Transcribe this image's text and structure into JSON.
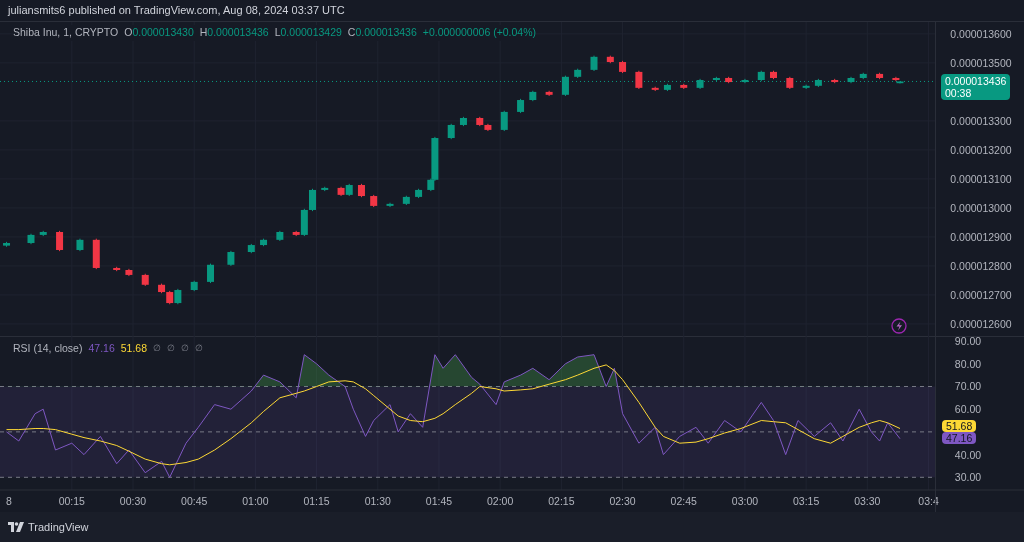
{
  "published": "juliansmits6 published on TradingView.com, Aug 08, 2024 03:37 UTC",
  "legend": {
    "symbol": "Shiba Inu, 1, CRYPTO",
    "ohlc": [
      {
        "label": "O",
        "value": "0.000013430"
      },
      {
        "label": "H",
        "value": "0.000013436"
      },
      {
        "label": "L",
        "value": "0.000013429"
      },
      {
        "label": "C",
        "value": "0.000013436"
      }
    ],
    "change": "+0.000000006 (+0.04%)"
  },
  "price_chart": {
    "chart_data": {
      "type": "candlestick",
      "grid": true,
      "x": [
        -1,
        5,
        8,
        12,
        17,
        21,
        26,
        29,
        33,
        37,
        39,
        41,
        45,
        49,
        54,
        59,
        62,
        66,
        70,
        72,
        74,
        77,
        81,
        83,
        86,
        89,
        93,
        97,
        100,
        103,
        104,
        108,
        111,
        115,
        117,
        121,
        125,
        128,
        132,
        136,
        139,
        143,
        147,
        150,
        154,
        158,
        161,
        165,
        169,
        173,
        176,
        180,
        184,
        187,
        191,
        195,
        198,
        202,
        206,
        209,
        213,
        217,
        218
      ],
      "xlim": [
        -2.6,
        248.4
      ],
      "ohlc": [
        [
          1.287e-05,
          1.2883e-05,
          1.2866e-05,
          1.2879e-05
        ],
        [
          1.2879e-05,
          1.2911e-05,
          1.2875e-05,
          1.2907e-05
        ],
        [
          1.2907e-05,
          1.2921e-05,
          1.2903e-05,
          1.2917e-05
        ],
        [
          1.2917e-05,
          1.2921e-05,
          1.2851e-05,
          1.2855e-05
        ],
        [
          1.2855e-05,
          1.2894e-05,
          1.2851e-05,
          1.289e-05
        ],
        [
          1.289e-05,
          1.2894e-05,
          1.2789e-05,
          1.2793e-05
        ],
        [
          1.2793e-05,
          1.2797e-05,
          1.2782e-05,
          1.2786e-05
        ],
        [
          1.2786e-05,
          1.279e-05,
          1.2765e-05,
          1.2769e-05
        ],
        [
          1.2769e-05,
          1.2773e-05,
          1.2731e-05,
          1.2735e-05
        ],
        [
          1.2735e-05,
          1.2739e-05,
          1.2706e-05,
          1.271e-05
        ],
        [
          1.271e-05,
          1.2714e-05,
          1.2668e-05,
          1.2672e-05
        ],
        [
          1.2672e-05,
          1.2721e-05,
          1.2668e-05,
          1.2717e-05
        ],
        [
          1.2717e-05,
          1.2749e-05,
          1.2713e-05,
          1.2745e-05
        ],
        [
          1.2745e-05,
          1.2808e-05,
          1.2741e-05,
          1.2804e-05
        ],
        [
          1.2804e-05,
          1.2852e-05,
          1.28e-05,
          1.2848e-05
        ],
        [
          1.2848e-05,
          1.2876e-05,
          1.2844e-05,
          1.2872e-05
        ],
        [
          1.2872e-05,
          1.2894e-05,
          1.2868e-05,
          1.289e-05
        ],
        [
          1.289e-05,
          1.2921e-05,
          1.2886e-05,
          1.2917e-05
        ],
        [
          1.2917e-05,
          1.2921e-05,
          1.2903e-05,
          1.2907e-05
        ],
        [
          1.2907e-05,
          1.2997e-05,
          1.2903e-05,
          1.2993e-05
        ],
        [
          1.2993e-05,
          1.3066e-05,
          1.2989e-05,
          1.3062e-05
        ],
        [
          1.3062e-05,
          1.3073e-05,
          1.3058e-05,
          1.3069e-05
        ],
        [
          1.3069e-05,
          1.3073e-05,
          1.3041e-05,
          1.3045e-05
        ],
        [
          1.3045e-05,
          1.3083e-05,
          1.3041e-05,
          1.3079e-05
        ],
        [
          1.3079e-05,
          1.3083e-05,
          1.3037e-05,
          1.3041e-05
        ],
        [
          1.3041e-05,
          1.3045e-05,
          1.3003e-05,
          1.3007e-05
        ],
        [
          1.3007e-05,
          1.3018e-05,
          1.3003e-05,
          1.3014e-05
        ],
        [
          1.3014e-05,
          1.3042e-05,
          1.301e-05,
          1.3038e-05
        ],
        [
          1.3038e-05,
          1.3066e-05,
          1.3034e-05,
          1.3062e-05
        ],
        [
          1.3062e-05,
          1.3101e-05,
          1.3058e-05,
          1.3097e-05
        ],
        [
          1.3097e-05,
          1.3245e-05,
          1.3093e-05,
          1.3241e-05
        ],
        [
          1.3241e-05,
          1.329e-05,
          1.3237e-05,
          1.3286e-05
        ],
        [
          1.3286e-05,
          1.3314e-05,
          1.3282e-05,
          1.331e-05
        ],
        [
          1.331e-05,
          1.3314e-05,
          1.3282e-05,
          1.3286e-05
        ],
        [
          1.3286e-05,
          1.329e-05,
          1.3265e-05,
          1.3269e-05
        ],
        [
          1.3269e-05,
          1.3335e-05,
          1.3265e-05,
          1.3331e-05
        ],
        [
          1.3331e-05,
          1.3376e-05,
          1.3327e-05,
          1.3372e-05
        ],
        [
          1.3372e-05,
          1.3404e-05,
          1.3368e-05,
          1.34e-05
        ],
        [
          1.34e-05,
          1.3404e-05,
          1.3386e-05,
          1.339e-05
        ],
        [
          1.339e-05,
          1.3456e-05,
          1.3386e-05,
          1.3452e-05
        ],
        [
          1.3452e-05,
          1.348e-05,
          1.3448e-05,
          1.3476e-05
        ],
        [
          1.3476e-05,
          1.3525e-05,
          1.3472e-05,
          1.3521e-05
        ],
        [
          1.3521e-05,
          1.3525e-05,
          1.3499e-05,
          1.3503e-05
        ],
        [
          1.3503e-05,
          1.3507e-05,
          1.3465e-05,
          1.3469e-05
        ],
        [
          1.3469e-05,
          1.3473e-05,
          1.341e-05,
          1.3414e-05
        ],
        [
          1.3414e-05,
          1.3418e-05,
          1.3403e-05,
          1.3407e-05
        ],
        [
          1.3407e-05,
          1.3428e-05,
          1.3403e-05,
          1.3424e-05
        ],
        [
          1.3424e-05,
          1.3428e-05,
          1.341e-05,
          1.3414e-05
        ],
        [
          1.3414e-05,
          1.3445e-05,
          1.341e-05,
          1.3441e-05
        ],
        [
          1.3441e-05,
          1.3452e-05,
          1.3437e-05,
          1.3448e-05
        ],
        [
          1.3448e-05,
          1.3452e-05,
          1.343e-05,
          1.3434e-05
        ],
        [
          1.3434e-05,
          1.3445e-05,
          1.343e-05,
          1.3441e-05
        ],
        [
          1.3441e-05,
          1.3473e-05,
          1.3437e-05,
          1.3469e-05
        ],
        [
          1.3469e-05,
          1.3473e-05,
          1.3444e-05,
          1.3448e-05
        ],
        [
          1.3448e-05,
          1.3452e-05,
          1.341e-05,
          1.3414e-05
        ],
        [
          1.3414e-05,
          1.3425e-05,
          1.341e-05,
          1.3421e-05
        ],
        [
          1.3421e-05,
          1.3445e-05,
          1.3417e-05,
          1.3441e-05
        ],
        [
          1.3441e-05,
          1.3445e-05,
          1.343e-05,
          1.3434e-05
        ],
        [
          1.3434e-05,
          1.3452e-05,
          1.343e-05,
          1.3448e-05
        ],
        [
          1.3448e-05,
          1.3466e-05,
          1.3444e-05,
          1.3462e-05
        ],
        [
          1.3462e-05,
          1.3466e-05,
          1.3444e-05,
          1.3448e-05
        ],
        [
          1.3448e-05,
          1.3452e-05,
          1.3437e-05,
          1.3441e-05
        ],
        [
          1.343e-05,
          1.3436e-05,
          1.3429e-05,
          1.3436e-05
        ]
      ],
      "ylim": [
        1.2555e-05,
        1.3641e-05
      ],
      "yticks": [
        {
          "value": 1.36e-05,
          "label": "0.000013600"
        },
        {
          "value": 1.35e-05,
          "label": "0.000013500"
        },
        {
          "value": 1.33e-05,
          "label": "0.000013300"
        },
        {
          "value": 1.32e-05,
          "label": "0.000013200"
        },
        {
          "value": 1.31e-05,
          "label": "0.000013100"
        },
        {
          "value": 1.3e-05,
          "label": "0.000013000"
        },
        {
          "value": 1.29e-05,
          "label": "0.000012900"
        },
        {
          "value": 1.28e-05,
          "label": "0.000012800"
        },
        {
          "value": 1.27e-05,
          "label": "0.000012700"
        },
        {
          "value": 1.26e-05,
          "label": "0.000012600"
        }
      ],
      "ref_lines": [
        {
          "value": 1.3436e-05,
          "axis": "y",
          "color": "#089981"
        }
      ]
    },
    "price_badge": {
      "price": "0.000013436",
      "countdown": "00:38"
    }
  },
  "rsi": {
    "legend": {
      "title": "RSI (14, close)",
      "rsi_value": "47.16",
      "ma_value": "51.68",
      "extras": [
        "∅",
        "∅",
        "∅",
        "∅"
      ]
    },
    "chart_data": {
      "type": "line",
      "grid": true,
      "x": [
        -1,
        2,
        6,
        8,
        11,
        15,
        18,
        22,
        26,
        29,
        33,
        37,
        39,
        43,
        46,
        50,
        54,
        59,
        62,
        66,
        70,
        72,
        75,
        78,
        82,
        84,
        87,
        89,
        93,
        95,
        98,
        101,
        104,
        106,
        109,
        113,
        115,
        119,
        121,
        125,
        128,
        132,
        136,
        139,
        143,
        146,
        148,
        150,
        154,
        158,
        160,
        164,
        168,
        171,
        175,
        179,
        184,
        187,
        190,
        193,
        197,
        201,
        204,
        208,
        211,
        213,
        215,
        218
      ],
      "series": [
        {
          "color": "#7e57c2",
          "values": [
            50,
            46,
            58,
            60,
            42,
            45,
            40,
            48,
            36,
            42,
            32,
            37,
            30,
            45,
            52,
            62,
            60,
            68,
            75,
            72,
            65,
            84,
            80,
            75,
            70,
            60,
            48,
            55,
            62,
            50,
            58,
            52,
            84,
            78,
            84,
            74,
            71,
            62,
            72,
            75,
            78,
            73,
            80,
            83,
            84,
            70,
            78,
            58,
            45,
            52,
            40,
            48,
            52,
            45,
            55,
            50,
            63,
            55,
            40,
            55,
            48,
            54,
            46,
            60,
            50,
            46,
            54,
            47
          ]
        },
        {
          "color": "#fdd835",
          "values": [
            51,
            51,
            51.5,
            51.5,
            51,
            49,
            47.5,
            46,
            44,
            41.5,
            38,
            36,
            35.5,
            36.5,
            38,
            42,
            47,
            54,
            59,
            65,
            67,
            68,
            70,
            72,
            72.5,
            72,
            69,
            66,
            60,
            57,
            55,
            54.5,
            56,
            58,
            62,
            67,
            70,
            69,
            68,
            68.5,
            69,
            71,
            73,
            75,
            78,
            79.5,
            77,
            73,
            63,
            52,
            48,
            45,
            45.5,
            47,
            49.5,
            51.5,
            55,
            54.5,
            54,
            51,
            47,
            45,
            48,
            52,
            54,
            55,
            54,
            51.5
          ]
        }
      ],
      "xlim": [
        -2.6,
        248.4
      ],
      "ylim": [
        24.4,
        91.8
      ],
      "bands": [
        {
          "from": 30,
          "to": 70,
          "axis": "y",
          "color": "#7e57c2"
        }
      ],
      "yticks": [
        {
          "value": 90,
          "label": "90.00"
        },
        {
          "value": 80,
          "label": "80.00"
        },
        {
          "value": 70,
          "label": "70.00"
        },
        {
          "value": 60,
          "label": "60.00"
        },
        {
          "value": 40,
          "label": "40.00"
        },
        {
          "value": 30,
          "label": "30.00"
        }
      ],
      "xticks": [
        {
          "value": 15,
          "label": "00:15"
        },
        {
          "value": 30,
          "label": "00:30"
        },
        {
          "value": 45,
          "label": "00:45"
        },
        {
          "value": 60,
          "label": "01:00"
        },
        {
          "value": 75,
          "label": "01:15"
        },
        {
          "value": 90,
          "label": "01:30"
        },
        {
          "value": 105,
          "label": "01:45"
        },
        {
          "value": 120,
          "label": "02:00"
        },
        {
          "value": 135,
          "label": "02:15"
        },
        {
          "value": 150,
          "label": "02:30"
        },
        {
          "value": 165,
          "label": "02:45"
        },
        {
          "value": 180,
          "label": "03:00"
        },
        {
          "value": 195,
          "label": "03:15"
        },
        {
          "value": 210,
          "label": "03:30"
        },
        {
          "value": 225,
          "label": "03:4"
        }
      ]
    },
    "date_label": "8",
    "badges": [
      {
        "text": "51.68",
        "color": "#fdd835"
      },
      {
        "text": "47.16",
        "color": "#7e57c2"
      }
    ]
  },
  "footer": {
    "brand": "TradingView"
  }
}
